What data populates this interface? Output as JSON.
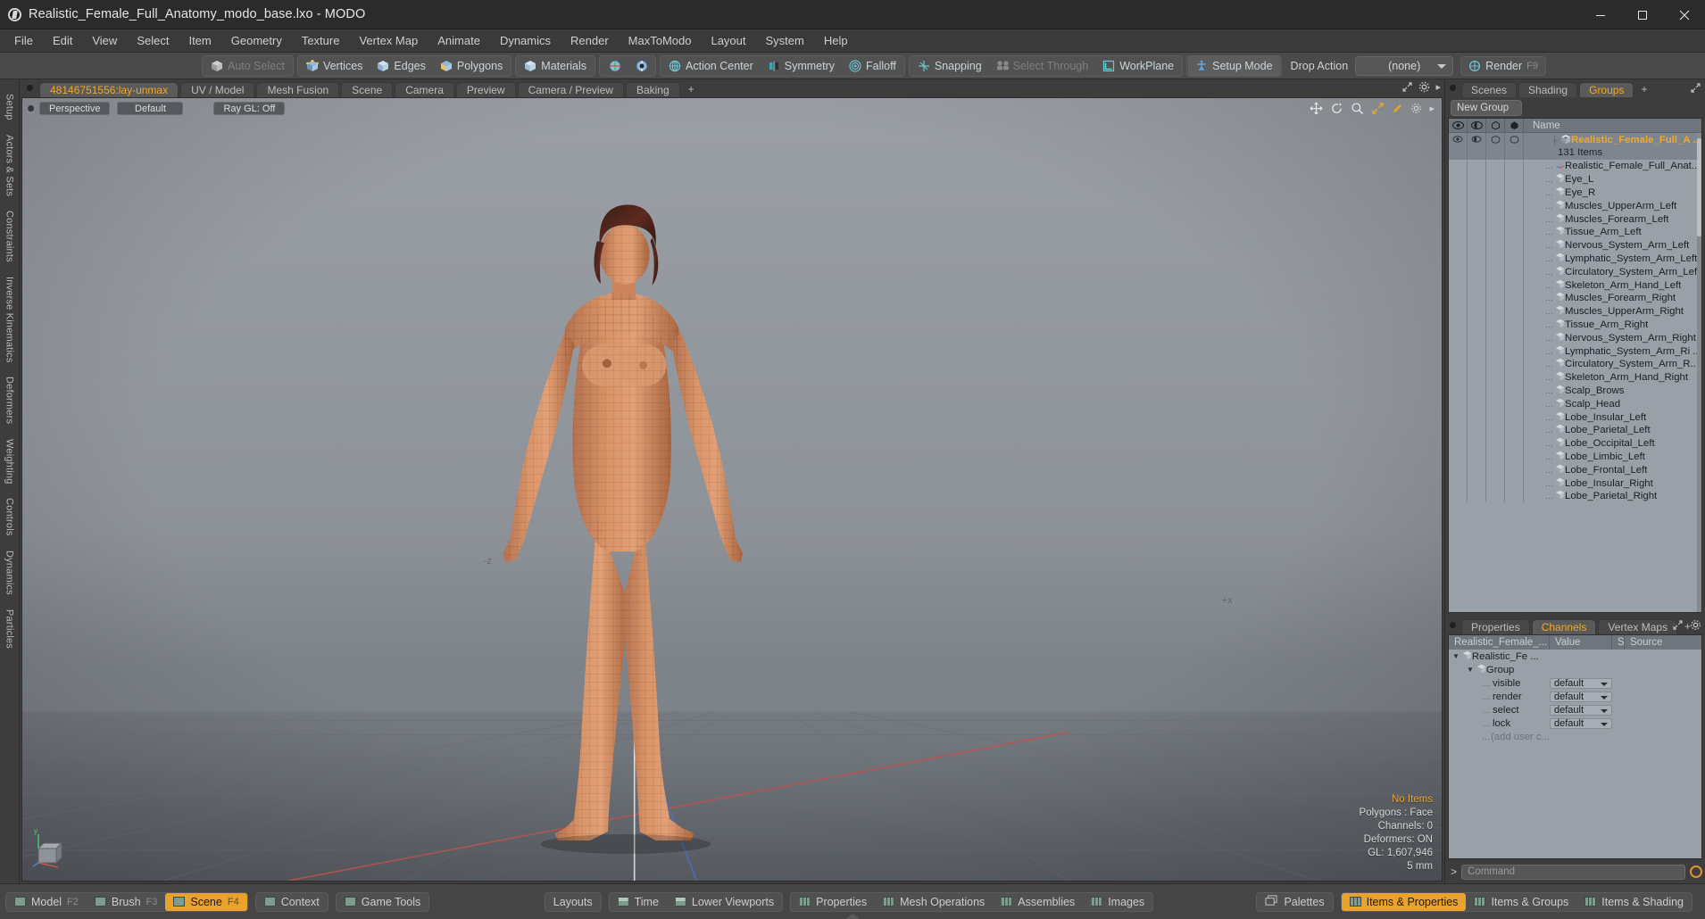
{
  "window": {
    "title": "Realistic_Female_Full_Anatomy_modo_base.lxo - MODO",
    "minimize": "—",
    "maximize": "☐",
    "close": "✕"
  },
  "menubar": {
    "items": [
      "File",
      "Edit",
      "View",
      "Select",
      "Item",
      "Geometry",
      "Texture",
      "Vertex Map",
      "Animate",
      "Dynamics",
      "Render",
      "MaxToModo",
      "Layout",
      "System",
      "Help"
    ]
  },
  "modebar": {
    "groups": [
      {
        "buttons": [
          {
            "label": "Auto Select",
            "icon": "cube-icon",
            "state": "dim"
          }
        ]
      },
      {
        "buttons": [
          {
            "label": "Vertices",
            "icon": "cube-vertex-icon",
            "state": "normal"
          },
          {
            "label": "Edges",
            "icon": "cube-edge-icon",
            "state": "normal"
          },
          {
            "label": "Polygons",
            "icon": "cube-polygon-icon",
            "state": "normal"
          }
        ]
      },
      {
        "buttons": [
          {
            "label": "Materials",
            "icon": "cube-material-icon",
            "state": "normal"
          }
        ]
      },
      {
        "buttons": [
          {
            "label": "",
            "icon": "item-mode-icon",
            "state": "normal"
          },
          {
            "label": "",
            "icon": "center-mode-icon",
            "state": "normal"
          }
        ]
      },
      {
        "buttons": [
          {
            "label": "Action Center",
            "icon": "action-center-icon",
            "state": "normal"
          },
          {
            "label": "Symmetry",
            "icon": "symmetry-icon",
            "state": "normal"
          },
          {
            "label": "Falloff",
            "icon": "falloff-icon",
            "state": "normal"
          }
        ]
      },
      {
        "buttons": [
          {
            "label": "Snapping",
            "icon": "snapping-icon",
            "state": "normal"
          },
          {
            "label": "Select Through",
            "icon": "select-through-icon",
            "state": "dim"
          },
          {
            "label": "WorkPlane",
            "icon": "workplane-icon",
            "state": "normal"
          }
        ]
      },
      {
        "buttons": [
          {
            "label": "Setup Mode",
            "icon": "setup-mode-icon",
            "state": "on"
          }
        ]
      }
    ],
    "drop_action_label": "Drop Action",
    "drop_action_value": "(none)",
    "render_label": "Render",
    "render_fkey": "F9"
  },
  "left_strip": {
    "tabs": [
      "Setup",
      "Actors & Sets",
      "Constraints",
      "Inverse Kinematics",
      "Deformers",
      "Weighting",
      "Controls",
      "Dynamics",
      "Particles"
    ]
  },
  "viewport": {
    "tabs": [
      {
        "label": "48146751556:lay-unmax",
        "active": true
      },
      {
        "label": "UV / Model",
        "active": false
      },
      {
        "label": "Mesh Fusion",
        "active": false
      },
      {
        "label": "Scene",
        "active": false
      },
      {
        "label": "Camera",
        "active": false
      },
      {
        "label": "Preview",
        "active": false
      },
      {
        "label": "Camera / Preview",
        "active": false
      },
      {
        "label": "Baking",
        "active": false
      },
      {
        "label": "+",
        "active": false
      }
    ],
    "chips": [
      "Perspective",
      "Default",
      "Ray GL: Off"
    ],
    "icons": [
      "move-icon",
      "rotate-icon",
      "zoom-icon",
      "fit-icon",
      "pen-icon",
      "gear-icon",
      "chevron-right-icon"
    ],
    "info": {
      "selection": "No Items",
      "polygons": "Polygons : Face",
      "channels": "Channels: 0",
      "deformers": "Deformers: ON",
      "gl": "GL: 1,607,946",
      "grid": "5 mm"
    },
    "axis": {
      "x": "x",
      "y": "y",
      "z": "z"
    },
    "origin_label": "-z",
    "plus_x_label": "+x"
  },
  "right_panel": {
    "tabs": [
      {
        "label": "Scenes",
        "active": false
      },
      {
        "label": "Shading",
        "active": false
      },
      {
        "label": "Groups",
        "active": true
      },
      {
        "label": "+",
        "active": false
      }
    ],
    "new_group_button": "New Group",
    "list_header": {
      "name": "Name",
      "cols": [
        "eye-icon",
        "render-icon",
        "select-icon",
        "lock-icon"
      ]
    },
    "group": {
      "name": "Realistic_Female_Full_A ...",
      "count": "131 Items"
    },
    "items": [
      {
        "label": "Realistic_Female_Full_Anat...",
        "icon": "locator-icon"
      },
      {
        "label": "Eye_L",
        "icon": "mesh-icon"
      },
      {
        "label": "Eye_R",
        "icon": "mesh-icon"
      },
      {
        "label": "Muscles_UpperArm_Left",
        "icon": "mesh-icon"
      },
      {
        "label": "Muscles_Forearm_Left",
        "icon": "mesh-icon"
      },
      {
        "label": "Tissue_Arm_Left",
        "icon": "mesh-icon"
      },
      {
        "label": "Nervous_System_Arm_Left",
        "icon": "mesh-icon"
      },
      {
        "label": "Lymphatic_System_Arm_Left",
        "icon": "mesh-icon"
      },
      {
        "label": "Circulatory_System_Arm_Left",
        "icon": "mesh-icon"
      },
      {
        "label": "Skeleton_Arm_Hand_Left",
        "icon": "mesh-icon"
      },
      {
        "label": "Muscles_Forearm_Right",
        "icon": "mesh-icon"
      },
      {
        "label": "Muscles_UpperArm_Right",
        "icon": "mesh-icon"
      },
      {
        "label": "Tissue_Arm_Right",
        "icon": "mesh-icon"
      },
      {
        "label": "Nervous_System_Arm_Right",
        "icon": "mesh-icon"
      },
      {
        "label": "Lymphatic_System_Arm_Ri ...",
        "icon": "mesh-icon"
      },
      {
        "label": "Circulatory_System_Arm_R...",
        "icon": "mesh-icon"
      },
      {
        "label": "Skeleton_Arm_Hand_Right",
        "icon": "mesh-icon"
      },
      {
        "label": "Scalp_Brows",
        "icon": "mesh-icon"
      },
      {
        "label": "Scalp_Head",
        "icon": "mesh-icon"
      },
      {
        "label": "Lobe_Insular_Left",
        "icon": "mesh-icon"
      },
      {
        "label": "Lobe_Parietal_Left",
        "icon": "mesh-icon"
      },
      {
        "label": "Lobe_Occipital_Left",
        "icon": "mesh-icon"
      },
      {
        "label": "Lobe_Limbic_Left",
        "icon": "mesh-icon"
      },
      {
        "label": "Lobe_Frontal_Left",
        "icon": "mesh-icon"
      },
      {
        "label": "Lobe_Insular_Right",
        "icon": "mesh-icon"
      },
      {
        "label": "Lobe_Parietal_Right",
        "icon": "mesh-icon"
      }
    ]
  },
  "channels_panel": {
    "tabs": [
      {
        "label": "Properties",
        "active": false
      },
      {
        "label": "Channels",
        "active": true
      },
      {
        "label": "Vertex Maps",
        "active": false
      },
      {
        "label": "+",
        "active": false
      }
    ],
    "icons": [
      "expand-icon",
      "gear-icon"
    ],
    "headers": [
      "Realistic_Female_...",
      "Value",
      "S",
      "Source"
    ],
    "tree": [
      {
        "label": "Realistic_Fe ...",
        "value": "",
        "depth": 0,
        "icon": "mesh-icon",
        "twirl": true
      },
      {
        "label": "Group",
        "value": "",
        "depth": 1,
        "icon": "mesh-icon",
        "twirl": true
      },
      {
        "label": "visible",
        "value": "default",
        "depth": 2,
        "icon": "none",
        "twirl": false
      },
      {
        "label": "render",
        "value": "default",
        "depth": 2,
        "icon": "none",
        "twirl": false
      },
      {
        "label": "select",
        "value": "default",
        "depth": 2,
        "icon": "none",
        "twirl": false
      },
      {
        "label": "lock",
        "value": "default",
        "depth": 2,
        "icon": "none",
        "twirl": false
      },
      {
        "label": "(add user c...",
        "value": "",
        "depth": 2,
        "icon": "none",
        "twirl": false
      }
    ],
    "command_prompt": ">",
    "command_placeholder": "Command"
  },
  "bottom_bar": {
    "left_groups": [
      [
        {
          "label": "Model",
          "fkey": "F2",
          "icon": "layout-icon",
          "active": false
        },
        {
          "label": "Brush",
          "fkey": "F3",
          "icon": "layout-icon",
          "active": false
        },
        {
          "label": "Scene",
          "fkey": "F4",
          "icon": "layout-icon",
          "active": true
        }
      ],
      [
        {
          "label": "Context",
          "fkey": "",
          "icon": "layout-icon",
          "active": false
        }
      ],
      [
        {
          "label": "Game Tools",
          "fkey": "",
          "icon": "layout-icon",
          "active": false
        }
      ]
    ],
    "center_groups": [
      [
        {
          "label": "Layouts",
          "icon": "none",
          "active": false
        }
      ],
      [
        {
          "label": "Time",
          "icon": "panel-h-icon",
          "active": false
        },
        {
          "label": "Lower Viewports",
          "icon": "panel-h-icon",
          "active": false
        }
      ],
      [
        {
          "label": "Properties",
          "icon": "panel-v-icon",
          "active": false
        },
        {
          "label": "Mesh Operations",
          "icon": "panel-v-icon",
          "active": false
        },
        {
          "label": "Assemblies",
          "icon": "panel-v-icon",
          "active": false
        },
        {
          "label": "Images",
          "icon": "panel-v-icon",
          "active": false
        }
      ]
    ],
    "right_groups": [
      [
        {
          "label": "Palettes",
          "icon": "palettes-icon",
          "active": false
        }
      ],
      [
        {
          "label": "Items & Properties",
          "icon": "panel-v-icon",
          "active": true
        },
        {
          "label": "Items & Groups",
          "icon": "panel-v-icon",
          "active": false
        },
        {
          "label": "Items & Shading",
          "icon": "panel-v-icon",
          "active": false
        }
      ]
    ]
  },
  "colors": {
    "accent": "#e9a22b",
    "teal": "#6fc3d2",
    "panel": "#3d3d3d",
    "list_bg": "#9aa0a8"
  }
}
